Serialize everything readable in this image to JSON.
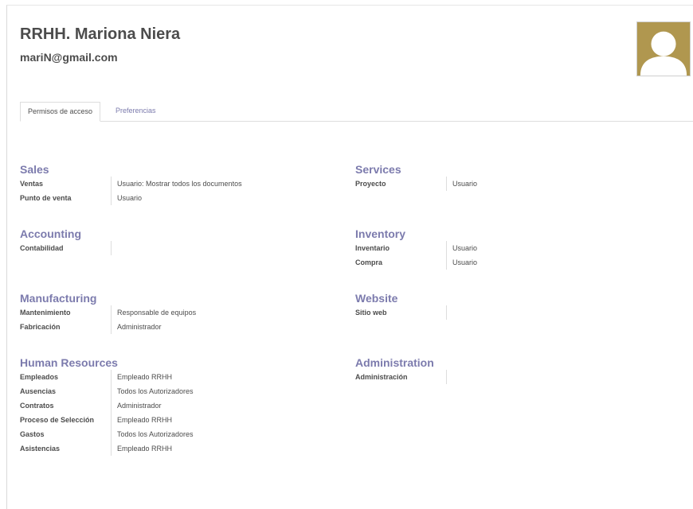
{
  "user": {
    "name": "RRHH. Mariona Niera",
    "email": "mariN@gmail.com"
  },
  "tabs": [
    {
      "label": "Permisos de acceso",
      "active": true
    },
    {
      "label": "Preferencias",
      "active": false
    }
  ],
  "groups": {
    "sales": {
      "title": "Sales",
      "rows": [
        {
          "label": "Ventas",
          "value": "Usuario: Mostrar todos los documentos"
        },
        {
          "label": "Punto de venta",
          "value": "Usuario"
        }
      ]
    },
    "services": {
      "title": "Services",
      "rows": [
        {
          "label": "Proyecto",
          "value": "Usuario"
        }
      ]
    },
    "accounting": {
      "title": "Accounting",
      "rows": [
        {
          "label": "Contabilidad",
          "value": ""
        }
      ]
    },
    "inventory": {
      "title": "Inventory",
      "rows": [
        {
          "label": "Inventario",
          "value": "Usuario"
        },
        {
          "label": "Compra",
          "value": "Usuario"
        }
      ]
    },
    "manufacturing": {
      "title": "Manufacturing",
      "rows": [
        {
          "label": "Mantenimiento",
          "value": "Responsable de equipos"
        },
        {
          "label": "Fabricación",
          "value": "Administrador"
        }
      ]
    },
    "website": {
      "title": "Website",
      "rows": [
        {
          "label": "Sitio web",
          "value": ""
        }
      ]
    },
    "human_resources": {
      "title": "Human Resources",
      "rows": [
        {
          "label": "Empleados",
          "value": "Empleado RRHH"
        },
        {
          "label": "Ausencias",
          "value": "Todos los Autorizadores"
        },
        {
          "label": "Contratos",
          "value": "Administrador"
        },
        {
          "label": "Proceso de Selección",
          "value": "Empleado RRHH"
        },
        {
          "label": "Gastos",
          "value": "Todos los Autorizadores"
        },
        {
          "label": "Asistencias",
          "value": "Empleado RRHH"
        }
      ]
    },
    "administration": {
      "title": "Administration",
      "rows": [
        {
          "label": "Administración",
          "value": ""
        }
      ]
    }
  },
  "colors": {
    "accent": "#7c7bad",
    "avatar_bg": "#b0974f",
    "text": "#4c4c4c"
  }
}
